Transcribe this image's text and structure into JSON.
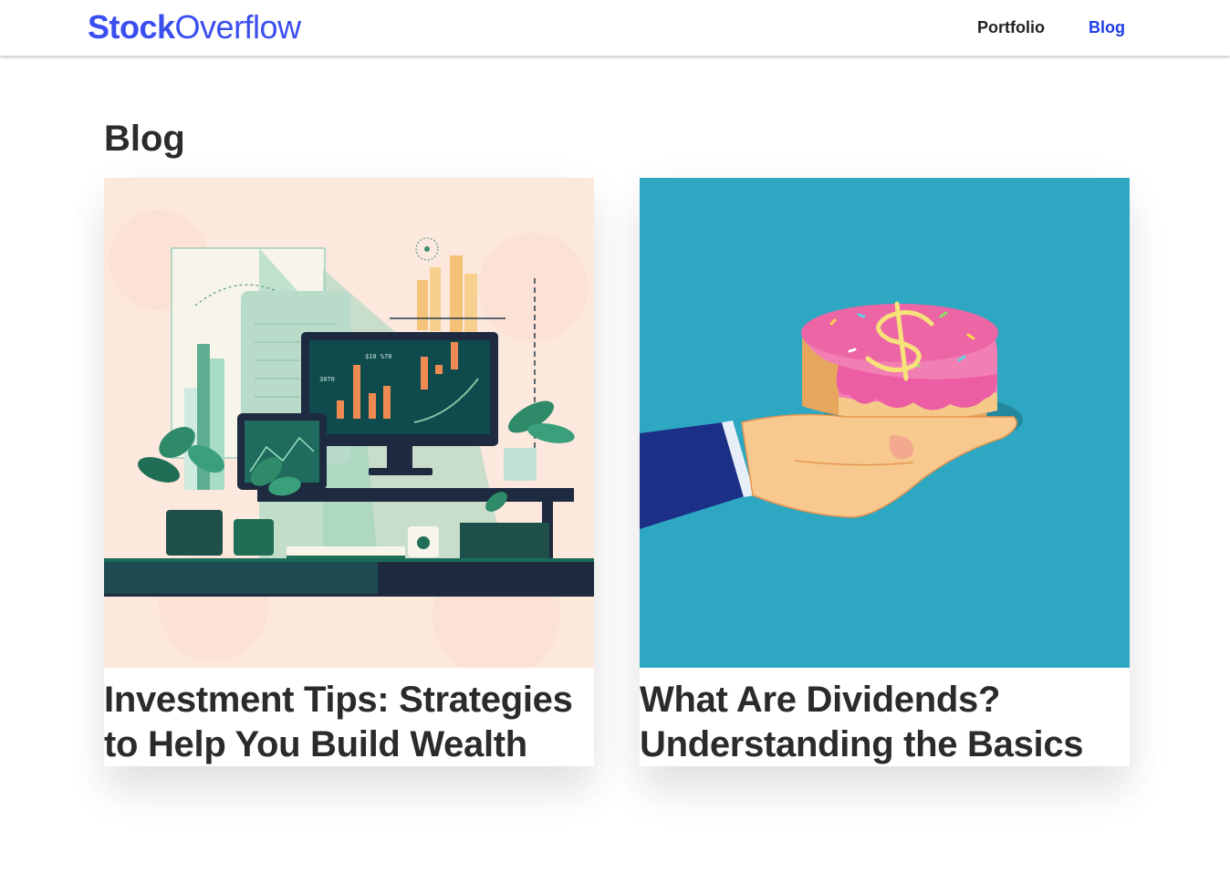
{
  "brand": {
    "name_bold": "Stock",
    "name_light": "Overflow",
    "color": "#3a4ef0"
  },
  "nav": {
    "items": [
      {
        "label": "Portfolio",
        "active": false
      },
      {
        "label": "Blog",
        "active": true
      }
    ],
    "active_color": "#1f3ce6"
  },
  "page": {
    "title": "Blog"
  },
  "posts": [
    {
      "title": "Investment Tips: Strategies to Help You Build Wealth",
      "image": "desk-with-stock-chart-monitors-and-plants-illustration",
      "image_screen_labels": [
        "$10 %70",
        "3070"
      ]
    },
    {
      "title": "What Are Dividends? Understanding the Basics",
      "image": "hand-holding-dollar-sign-donut-cake-illustration"
    }
  ]
}
